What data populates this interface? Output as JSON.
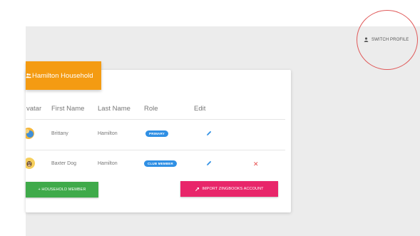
{
  "header": {
    "switch_profile_label": "SWITCH PROFILE",
    "icon": "person-icon"
  },
  "household": {
    "title": "Hamilton Household",
    "icon": "people-icon"
  },
  "table": {
    "columns": [
      "vatar",
      "First Name",
      "Last Name",
      "Role",
      "Edit"
    ],
    "rows": [
      {
        "first_name": "Brittany",
        "last_name": "Hamilton",
        "role": "PRIMARY",
        "editable": true,
        "removable": false
      },
      {
        "first_name": "Baxter Dog",
        "last_name": "Hamilton",
        "role": "CLUB MEMBER",
        "editable": true,
        "removable": true
      }
    ]
  },
  "actions": {
    "add_member_label": "+ HOUSEHOLD MEMBER",
    "import_label": "IMPORT ZINGBOOKS ACCOUNT",
    "import_icon": "link-icon"
  },
  "colors": {
    "household_tab": "#f49b12",
    "pill": "#2f8fe4",
    "add_button": "#3faa4a",
    "import_button": "#e8266a",
    "annotation_circle": "#e05a5a"
  }
}
